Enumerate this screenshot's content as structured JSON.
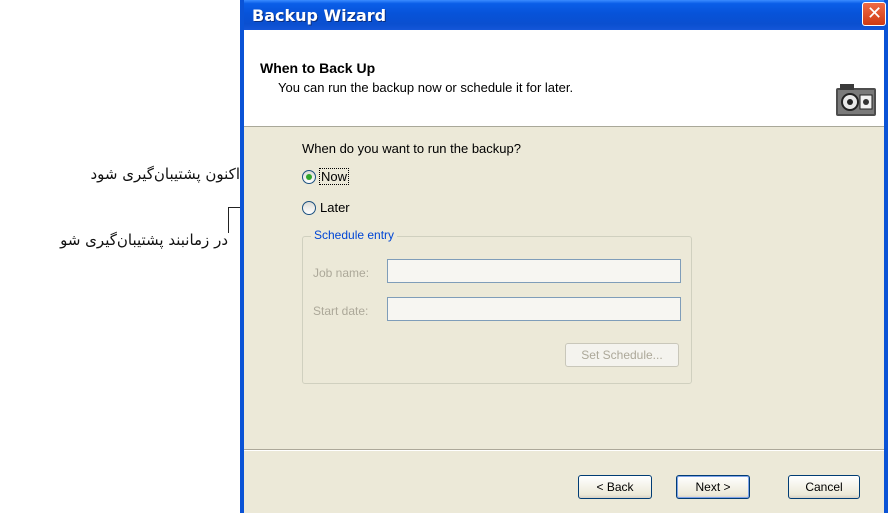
{
  "annotations": {
    "now_label": "اکنون پشتیبان‌گیری شود",
    "later_label": "در زمانبند پشتیبان‌گیری شو"
  },
  "window": {
    "title": "Backup Wizard",
    "close_glyph": "✕"
  },
  "header": {
    "title": "When to Back Up",
    "subtitle": "You can run the backup now or schedule it for later.",
    "icon": "backup-camera-icon"
  },
  "body": {
    "question": "When do you want to run the backup?",
    "options": [
      {
        "label": "Now",
        "selected": true
      },
      {
        "label": "Later",
        "selected": false
      }
    ],
    "schedule_group": {
      "legend": "Schedule entry",
      "job_name_label": "Job name:",
      "job_name_value": "",
      "start_date_label": "Start date:",
      "start_date_value": "",
      "set_schedule_button": "Set Schedule..."
    }
  },
  "footer": {
    "back_button": "< Back",
    "next_button": "Next >",
    "cancel_button": "Cancel"
  },
  "colors": {
    "titlebar_blue": "#0753d9",
    "dialog_bg": "#ece9d8",
    "legend_blue": "#0046d5",
    "radio_dot": "#2fa52b",
    "close_red": "#cf3a13"
  }
}
